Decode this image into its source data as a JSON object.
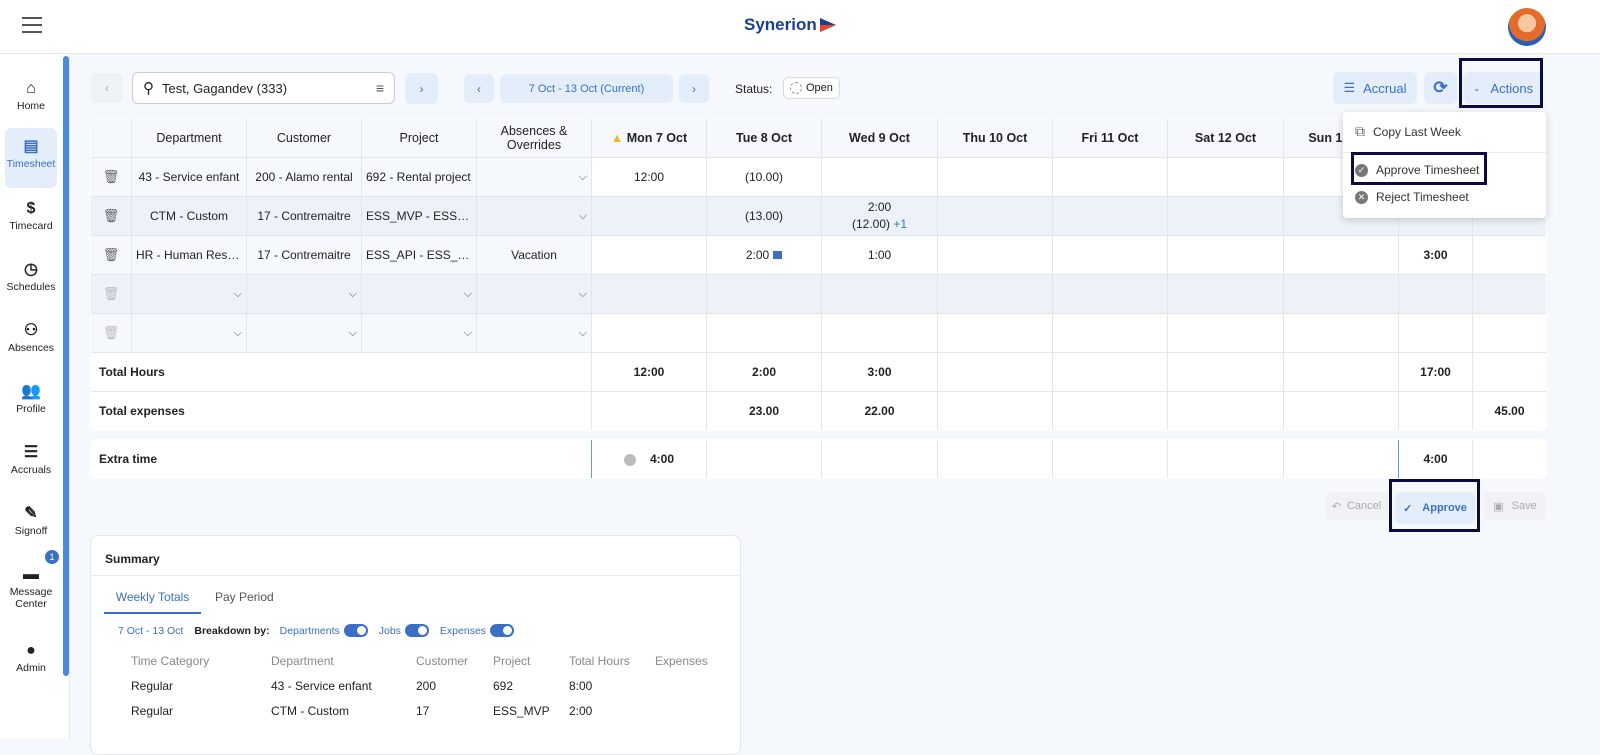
{
  "header": {
    "logo": "Synerion"
  },
  "sidebar": {
    "items": [
      {
        "label": "Home",
        "icon": "⌂",
        "name": "home"
      },
      {
        "label": "Timesheet",
        "icon": "▤",
        "name": "timesheet",
        "active": true
      },
      {
        "label": "Timecard",
        "icon": "$",
        "name": "timecard"
      },
      {
        "label": "Schedules",
        "icon": "◷",
        "name": "schedules"
      },
      {
        "label": "Absences",
        "icon": "⚇",
        "name": "absences"
      },
      {
        "label": "Profile",
        "icon": "👥",
        "name": "profile"
      },
      {
        "label": "Accruals",
        "icon": "☰",
        "name": "accruals"
      },
      {
        "label": "Signoff",
        "icon": "✎",
        "name": "signoff"
      },
      {
        "label": "Message Center",
        "icon": "▬",
        "name": "message-center",
        "badge": "1"
      },
      {
        "label": "Admin",
        "icon": "●",
        "name": "admin"
      }
    ]
  },
  "toolbar": {
    "employee": "Test, Gagandev (333)",
    "period": "7 Oct - 13 Oct (Current)",
    "status_label": "Status:",
    "status": "Open",
    "accrual": "Accrual",
    "actions": "Actions"
  },
  "actions_menu": {
    "items": [
      "Copy Last Week",
      "Approve Timesheet",
      "Reject Timesheet"
    ]
  },
  "grid": {
    "headers": [
      "",
      "Department",
      "Customer",
      "Project",
      "Absences & Overrides",
      "Mon 7 Oct",
      "Tue 8 Oct",
      "Wed 9 Oct",
      "Thu 10 Oct",
      "Fri 11 Oct",
      "Sat 12 Oct",
      "Sun 13 Oct",
      "",
      ""
    ],
    "warning_day": "Mon 7 Oct",
    "rows": [
      {
        "dept": "43 - Service enfant",
        "cust": "200 - Alamo rental",
        "proj": "692 - Rental project",
        "abs": "",
        "days": [
          "12:00",
          "(10.00)",
          "",
          "",
          "",
          "",
          ""
        ],
        "total": "",
        "exp": ""
      },
      {
        "dept": "CTM - Custom",
        "cust": "17 - Contremaitre",
        "proj": "ESS_MVP - ESS_...",
        "abs": "",
        "days": [
          "",
          "(13.00)",
          "2:00|(12.00)|+1",
          "",
          "",
          "",
          ""
        ],
        "total": "",
        "exp": ""
      },
      {
        "dept": "HR - Human Reso...",
        "cust": "17 - Contremaitre",
        "proj": "ESS_API - ESS_AP...",
        "abs": "Vacation",
        "days": [
          "",
          "2:00",
          "1:00",
          "",
          "",
          "",
          ""
        ],
        "total": "3:00",
        "exp": ""
      },
      {
        "dept": "",
        "cust": "",
        "proj": "",
        "abs": "",
        "days": [
          "",
          "",
          "",
          "",
          "",
          "",
          ""
        ],
        "total": "",
        "exp": "",
        "empty": true
      },
      {
        "dept": "",
        "cust": "",
        "proj": "",
        "abs": "",
        "days": [
          "",
          "",
          "",
          "",
          "",
          "",
          ""
        ],
        "total": "",
        "exp": "",
        "empty": true
      }
    ],
    "totals": [
      {
        "label": "Total Hours",
        "days": [
          "12:00",
          "2:00",
          "3:00",
          "",
          "",
          "",
          ""
        ],
        "total": "17:00",
        "exp": ""
      },
      {
        "label": "Total expenses",
        "days": [
          "",
          "23.00",
          "22.00",
          "",
          "",
          "",
          ""
        ],
        "total": "",
        "exp": "45.00"
      }
    ],
    "extra": {
      "label": "Extra time",
      "days": [
        "4:00",
        "",
        "",
        "",
        "",
        "",
        ""
      ],
      "total": "4:00",
      "exp": ""
    }
  },
  "footer": {
    "cancel": "Cancel",
    "approve": "Approve",
    "save": "Save"
  },
  "summary": {
    "title": "Summary",
    "tabs": [
      "Weekly Totals",
      "Pay Period"
    ],
    "range": "7 Oct - 13 Oct",
    "breakdown": "Breakdown by:",
    "toggles": [
      "Departments",
      "Jobs",
      "Expenses"
    ],
    "columns": [
      "Time Category",
      "Department",
      "Customer",
      "Project",
      "Total Hours",
      "Expenses"
    ],
    "rows": [
      [
        "Regular",
        "43 - Service enfant",
        "200",
        "692",
        "8:00",
        ""
      ],
      [
        "Regular",
        "CTM - Custom",
        "17",
        "ESS_MVP",
        "2:00",
        ""
      ]
    ]
  },
  "colors": {
    "accent": "#3a6fc4",
    "highlight": "#0b0b3f"
  }
}
